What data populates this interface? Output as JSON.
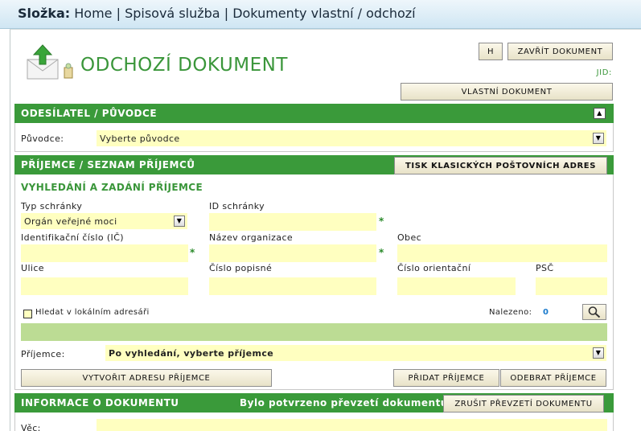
{
  "breadcrumb": {
    "label": "Složka:",
    "items": [
      "Home",
      "Spisová služba",
      "Dokumenty vlastní / odchozí"
    ],
    "separator": "|"
  },
  "header": {
    "title": "ODCHOZÍ DOKUMENT",
    "h_button": "H",
    "close_button": "ZAVŘÍT DOKUMENT",
    "jid_label": "JID:",
    "own_document_button": "VLASTNÍ DOKUMENT"
  },
  "sender": {
    "bar_title": "ODESÍLATEL / PŮVODCE",
    "origin_label": "Původce:",
    "origin_value": "Vyberte původce"
  },
  "recipients": {
    "bar_title": "PŘÍJEMCE / SEZNAM PŘÍJEMCŮ",
    "print_button": "TISK KLASICKÝCH POŠTOVNÍCH ADRES",
    "search_heading": "VYHLEDÁNÍ A ZADÁNÍ PŘÍJEMCE",
    "box_type_label": "Typ schránky",
    "box_type_value": "Orgán veřejné moci",
    "box_id_label": "ID schránky",
    "ic_label": "Identifikační číslo (IČ)",
    "org_name_label": "Název organizace",
    "city_label": "Obec",
    "street_label": "Ulice",
    "house_no_label": "Číslo popisné",
    "orientation_no_label": "Číslo orientační",
    "zip_label": "PSČ",
    "required_mark": "*",
    "local_search_label": "Hledat v lokálním adresáři",
    "found_label": "Nalezeno:",
    "found_count": "0",
    "recipient_label": "Příjemce:",
    "recipient_value": "Po vyhledání, vyberte příjemce",
    "create_button": "VYTVOŘIT ADRESU PŘÍJEMCE",
    "add_button": "PŘIDAT PŘÍJEMCE",
    "remove_button": "ODEBRAT PŘÍJEMCE"
  },
  "doc_info": {
    "bar_title": "INFORMACE O DOKUMENTU",
    "confirmed_text": "Bylo potvrzeno převzetí dokumentu",
    "cancel_button": "ZRUŠIT PŘEVZETÍ DOKUMENTU",
    "subject_label": "Věc:"
  },
  "colors": {
    "accent_green": "#3a9a3a",
    "field_yellow": "#ffffc0",
    "found_blue": "#1a7acc"
  }
}
